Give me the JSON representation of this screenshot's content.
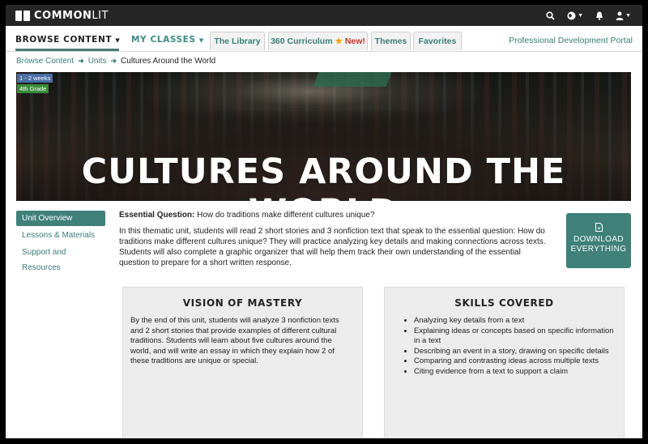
{
  "brand": {
    "logo_text_bold": "COMMON",
    "logo_text_light": "LIT"
  },
  "top_icons": [
    "search-icon",
    "globe-icon",
    "bell-icon",
    "user-icon"
  ],
  "nav": {
    "browse_content": "BROWSE CONTENT",
    "my_classes": "MY CLASSES",
    "tabs": [
      {
        "label": "The Library"
      },
      {
        "label": "360 Curriculum",
        "star": "★",
        "badge": "New!"
      },
      {
        "label": "Themes"
      },
      {
        "label": "Favorites"
      }
    ],
    "pd_portal": "Professional Development Portal"
  },
  "breadcrumb": {
    "items": [
      "Browse Content",
      "Units"
    ],
    "current": "Cultures Around the World"
  },
  "banner": {
    "title": "CULTURES AROUND THE WORLD",
    "badges": {
      "duration": "1 - 2 weeks",
      "grade": "4th Grade"
    }
  },
  "sidebar": {
    "items": [
      {
        "label": "Unit Overview",
        "active": true
      },
      {
        "label": "Lessons & Materials"
      },
      {
        "label": "Support and Resources"
      }
    ]
  },
  "main": {
    "essential_question_label": "Essential Question:",
    "essential_question": "How do traditions make different cultures unique?",
    "intro": "In this thematic unit, students will read 2 short stories and 3 nonfiction text that speak to the essential question: How do traditions make different cultures unique? They will practice analyzing key details and making connections across texts. Students will also complete a graphic organizer that will help them track their own understanding of the essential question to prepare for a short written response.",
    "download_line1": "DOWNLOAD",
    "download_line2": "EVERYTHING"
  },
  "vision": {
    "title": "VISION OF MASTERY",
    "text": "By the end of this unit, students will analyze 3 nonfiction texts and 2 short stories that provide examples of different cultural traditions. Students will learn about five cultures around the world, and will write an essay in which they explain how 2 of these traditions are unique or special."
  },
  "skills": {
    "title": "SKILLS COVERED",
    "items": [
      "Analyzing key details from a text",
      "Explaining ideas or concepts based on specific information in a text",
      "Describing an event in a story, drawing on specific details",
      "Comparing and contrasting ideas across multiple texts",
      "Citing evidence from a text to support a claim"
    ]
  },
  "colors": {
    "accent": "#3f8079",
    "link": "#3a7d77",
    "topbar": "#262626",
    "new_badge": "#c0392b"
  }
}
